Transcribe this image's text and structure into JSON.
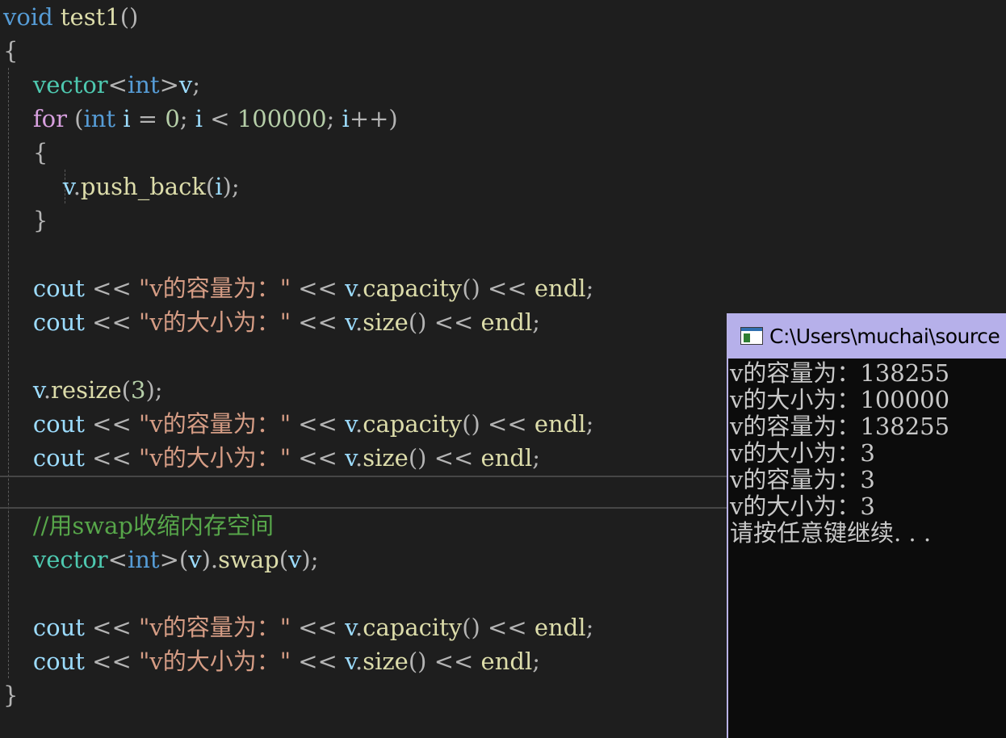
{
  "editor": {
    "colors": {
      "background": "#1e1e1e",
      "keyword": "#569cd6",
      "control": "#d8a0df",
      "type": "#4ec9b0",
      "function": "#dcdcaa",
      "variable": "#9cdcfe",
      "number": "#b5cea8",
      "string": "#d69d85",
      "comment": "#57a64a"
    },
    "lines": [
      [
        {
          "t": "void",
          "c": "kw"
        },
        {
          "t": " "
        },
        {
          "t": "test1",
          "c": "fn"
        },
        {
          "t": "()",
          "c": "pun"
        }
      ],
      [
        {
          "t": "{",
          "c": "pun"
        }
      ],
      [
        {
          "t": "    "
        },
        {
          "t": "vector",
          "c": "type"
        },
        {
          "t": "<",
          "c": "pun"
        },
        {
          "t": "int",
          "c": "kw"
        },
        {
          "t": ">",
          "c": "pun"
        },
        {
          "t": "v",
          "c": "var"
        },
        {
          "t": ";",
          "c": "pun"
        }
      ],
      [
        {
          "t": "    "
        },
        {
          "t": "for",
          "c": "ctrl"
        },
        {
          "t": " "
        },
        {
          "t": "(",
          "c": "pun"
        },
        {
          "t": "int",
          "c": "kw"
        },
        {
          "t": " "
        },
        {
          "t": "i",
          "c": "var"
        },
        {
          "t": " = ",
          "c": "pun"
        },
        {
          "t": "0",
          "c": "num"
        },
        {
          "t": "; ",
          "c": "pun"
        },
        {
          "t": "i",
          "c": "var"
        },
        {
          "t": " < ",
          "c": "pun"
        },
        {
          "t": "100000",
          "c": "num"
        },
        {
          "t": "; ",
          "c": "pun"
        },
        {
          "t": "i",
          "c": "var"
        },
        {
          "t": "++)",
          "c": "pun"
        }
      ],
      [
        {
          "t": "    "
        },
        {
          "t": "{",
          "c": "pun"
        }
      ],
      [
        {
          "t": "        "
        },
        {
          "t": "v",
          "c": "var"
        },
        {
          "t": ".",
          "c": "pun"
        },
        {
          "t": "push_back",
          "c": "fn"
        },
        {
          "t": "(",
          "c": "pun"
        },
        {
          "t": "i",
          "c": "var"
        },
        {
          "t": ");",
          "c": "pun"
        }
      ],
      [
        {
          "t": "    "
        },
        {
          "t": "}",
          "c": "pun"
        }
      ],
      [],
      [
        {
          "t": "    "
        },
        {
          "t": "cout",
          "c": "var"
        },
        {
          "t": " << ",
          "c": "pun"
        },
        {
          "t": "\"v的容量为：\"",
          "c": "str"
        },
        {
          "t": " << ",
          "c": "pun"
        },
        {
          "t": "v",
          "c": "var"
        },
        {
          "t": ".",
          "c": "pun"
        },
        {
          "t": "capacity",
          "c": "fn"
        },
        {
          "t": "()",
          "c": "pun"
        },
        {
          "t": " << ",
          "c": "pun"
        },
        {
          "t": "endl",
          "c": "fn"
        },
        {
          "t": ";",
          "c": "pun"
        }
      ],
      [
        {
          "t": "    "
        },
        {
          "t": "cout",
          "c": "var"
        },
        {
          "t": " << ",
          "c": "pun"
        },
        {
          "t": "\"v的大小为：\"",
          "c": "str"
        },
        {
          "t": " << ",
          "c": "pun"
        },
        {
          "t": "v",
          "c": "var"
        },
        {
          "t": ".",
          "c": "pun"
        },
        {
          "t": "size",
          "c": "fn"
        },
        {
          "t": "()",
          "c": "pun"
        },
        {
          "t": " << ",
          "c": "pun"
        },
        {
          "t": "endl",
          "c": "fn"
        },
        {
          "t": ";",
          "c": "pun"
        }
      ],
      [],
      [
        {
          "t": "    "
        },
        {
          "t": "v",
          "c": "var"
        },
        {
          "t": ".",
          "c": "pun"
        },
        {
          "t": "resize",
          "c": "fn"
        },
        {
          "t": "(",
          "c": "pun"
        },
        {
          "t": "3",
          "c": "num"
        },
        {
          "t": ");",
          "c": "pun"
        }
      ],
      [
        {
          "t": "    "
        },
        {
          "t": "cout",
          "c": "var"
        },
        {
          "t": " << ",
          "c": "pun"
        },
        {
          "t": "\"v的容量为：\"",
          "c": "str"
        },
        {
          "t": " << ",
          "c": "pun"
        },
        {
          "t": "v",
          "c": "var"
        },
        {
          "t": ".",
          "c": "pun"
        },
        {
          "t": "capacity",
          "c": "fn"
        },
        {
          "t": "()",
          "c": "pun"
        },
        {
          "t": " << ",
          "c": "pun"
        },
        {
          "t": "endl",
          "c": "fn"
        },
        {
          "t": ";",
          "c": "pun"
        }
      ],
      [
        {
          "t": "    "
        },
        {
          "t": "cout",
          "c": "var"
        },
        {
          "t": " << ",
          "c": "pun"
        },
        {
          "t": "\"v的大小为：\"",
          "c": "str"
        },
        {
          "t": " << ",
          "c": "pun"
        },
        {
          "t": "v",
          "c": "var"
        },
        {
          "t": ".",
          "c": "pun"
        },
        {
          "t": "size",
          "c": "fn"
        },
        {
          "t": "()",
          "c": "pun"
        },
        {
          "t": " << ",
          "c": "pun"
        },
        {
          "t": "endl",
          "c": "fn"
        },
        {
          "t": ";",
          "c": "pun"
        }
      ],
      [],
      [
        {
          "t": "    "
        },
        {
          "t": "//用swap收缩内存空间",
          "c": "cm"
        }
      ],
      [
        {
          "t": "    "
        },
        {
          "t": "vector",
          "c": "type"
        },
        {
          "t": "<",
          "c": "pun"
        },
        {
          "t": "int",
          "c": "kw"
        },
        {
          "t": ">(",
          "c": "pun"
        },
        {
          "t": "v",
          "c": "var"
        },
        {
          "t": ").",
          "c": "pun"
        },
        {
          "t": "swap",
          "c": "fn"
        },
        {
          "t": "(",
          "c": "pun"
        },
        {
          "t": "v",
          "c": "var"
        },
        {
          "t": ");",
          "c": "pun"
        }
      ],
      [],
      [
        {
          "t": "    "
        },
        {
          "t": "cout",
          "c": "var"
        },
        {
          "t": " << ",
          "c": "pun"
        },
        {
          "t": "\"v的容量为：\"",
          "c": "str"
        },
        {
          "t": " << ",
          "c": "pun"
        },
        {
          "t": "v",
          "c": "var"
        },
        {
          "t": ".",
          "c": "pun"
        },
        {
          "t": "capacity",
          "c": "fn"
        },
        {
          "t": "()",
          "c": "pun"
        },
        {
          "t": " << ",
          "c": "pun"
        },
        {
          "t": "endl",
          "c": "fn"
        },
        {
          "t": ";",
          "c": "pun"
        }
      ],
      [
        {
          "t": "    "
        },
        {
          "t": "cout",
          "c": "var"
        },
        {
          "t": " << ",
          "c": "pun"
        },
        {
          "t": "\"v的大小为：\"",
          "c": "str"
        },
        {
          "t": " << ",
          "c": "pun"
        },
        {
          "t": "v",
          "c": "var"
        },
        {
          "t": ".",
          "c": "pun"
        },
        {
          "t": "size",
          "c": "fn"
        },
        {
          "t": "()",
          "c": "pun"
        },
        {
          "t": " << ",
          "c": "pun"
        },
        {
          "t": "endl",
          "c": "fn"
        },
        {
          "t": ";",
          "c": "pun"
        }
      ],
      [
        {
          "t": "}",
          "c": "pun"
        }
      ]
    ]
  },
  "console": {
    "title": "C:\\Users\\muchai\\source",
    "icon": "console-app-icon",
    "titlebar_color": "#b6b0ea",
    "background_color": "#0c0c0c",
    "output": [
      "v的容量为：138255",
      "v的大小为：100000",
      "v的容量为：138255",
      "v的大小为：3",
      "v的容量为：3",
      "v的大小为：3",
      "请按任意键继续. . ."
    ]
  }
}
